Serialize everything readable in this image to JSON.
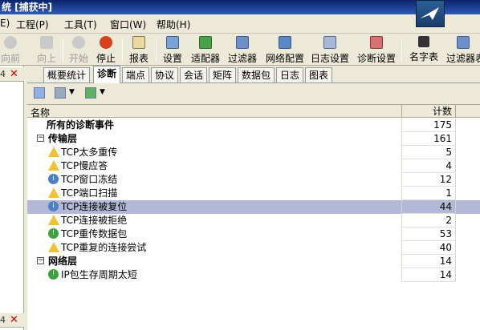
{
  "window": {
    "title": "统 [捕获中]"
  },
  "menu": {
    "items": [
      "E)",
      "工程(P)",
      "工具(T)",
      "窗口(W)",
      "帮助(H)"
    ]
  },
  "toolbar": {
    "buttons": [
      "向前",
      "向上",
      "开始",
      "停止",
      "报表",
      "设置",
      "适配器",
      "过滤器",
      "网络配置",
      "日志设置",
      "诊断设置",
      "名字表",
      "过滤器表"
    ]
  },
  "tabs": [
    "概要统计",
    "诊断",
    "端点",
    "协议",
    "会话",
    "矩阵",
    "数据包",
    "日志",
    "图表"
  ],
  "active_tab": "诊断",
  "grid": {
    "headers": {
      "name": "名称",
      "count": "计数"
    },
    "rows": [
      {
        "name": "所有的诊断事件",
        "count": "175",
        "level": 1,
        "bold": true,
        "icon": "none"
      },
      {
        "name": "传输层",
        "count": "161",
        "level": 0,
        "bold": true,
        "icon": "expander"
      },
      {
        "name": "TCP太多重传",
        "count": "5",
        "level": 2,
        "icon": "warning-icon"
      },
      {
        "name": "TCP慢应答",
        "count": "4",
        "level": 2,
        "icon": "warning-icon"
      },
      {
        "name": "TCP窗口冻结",
        "count": "12",
        "level": 2,
        "icon": "info-icon"
      },
      {
        "name": "TCP端口扫描",
        "count": "1",
        "level": 2,
        "icon": "warning-icon"
      },
      {
        "name": "TCP连接被复位",
        "count": "44",
        "level": 2,
        "icon": "info-icon",
        "selected": true
      },
      {
        "name": "TCP连接被拒绝",
        "count": "2",
        "level": 2,
        "icon": "warning-icon"
      },
      {
        "name": "TCP重传数据包",
        "count": "53",
        "level": 2,
        "icon": "ok-icon"
      },
      {
        "name": "TCP重复的连接尝试",
        "count": "40",
        "level": 2,
        "icon": "warning-icon"
      },
      {
        "name": "网络层",
        "count": "14",
        "level": 0,
        "bold": true,
        "icon": "expander"
      },
      {
        "name": "IP包生存周期太短",
        "count": "14",
        "level": 2,
        "icon": "ok-icon"
      }
    ]
  },
  "left_panel": {
    "top_num": "4",
    "bottom_num": "4"
  }
}
